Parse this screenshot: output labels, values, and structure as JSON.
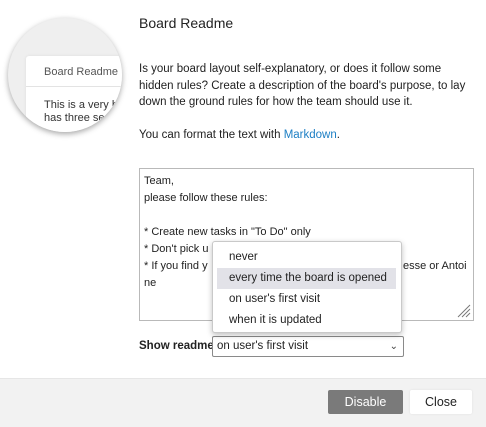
{
  "dialog": {
    "title": "Board Readme",
    "description": "Is your board layout self-explanatory, or does it follow some hidden rules? Create a description of the board's purpose, to lay down the ground rules for how the team should use it.",
    "format_note_prefix": "You can format the text with ",
    "format_link": "Markdown",
    "format_note_suffix": "."
  },
  "preview": {
    "title": "Board Readme",
    "line1": "This is a very b",
    "line2": "has three se"
  },
  "readme": {
    "lines": [
      "Team,",
      "please follow these rules:",
      "",
      "* Create new tasks in \"To Do\" only",
      "* Don't pick u",
      "* If you find y",
      "ne"
    ],
    "line5_tail": "esse or Antoi"
  },
  "show_readme": {
    "label": "Show readme",
    "selected": "on user's first visit",
    "options": [
      "never",
      "every time the board is opened",
      "on user's first visit",
      "when it is updated"
    ],
    "highlighted_index": 1
  },
  "buttons": {
    "disable": "Disable",
    "close": "Close"
  },
  "colors": {
    "link": "#1d7fc4",
    "primary_button": "#7a7a7a",
    "option_highlight": "#e2e2e8"
  }
}
